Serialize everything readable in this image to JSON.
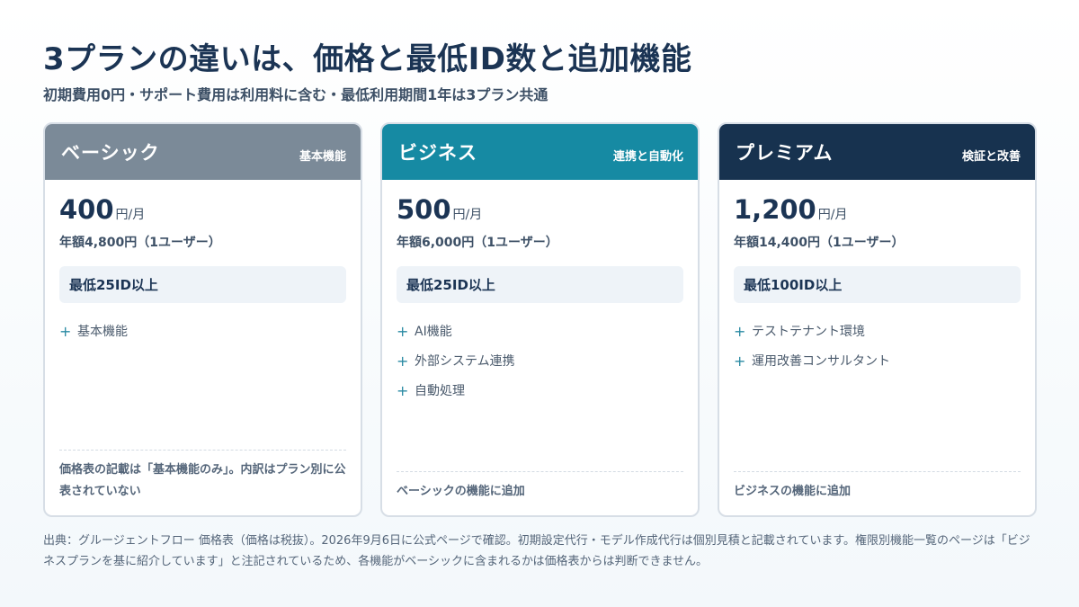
{
  "header": {
    "title": "3プランの違いは、価格と最低ID数と追加機能",
    "subtitle": "初期費用0円・サポート費用は利用料に含む・最低利用期間1年は3プラン共通"
  },
  "colors": {
    "basic": "#7b8a98",
    "business": "#168aa3",
    "premium": "#17324f"
  },
  "plans": [
    {
      "name": "ベーシック",
      "tag": "基本機能",
      "price": "400",
      "unit": "円/月",
      "annual": "年額4,800円（1ユーザー）",
      "min_ids": "最低25ID以上",
      "features": [
        "基本機能"
      ],
      "note": "価格表の記載は「基本機能のみ」。内訳はプラン別に公表されていない"
    },
    {
      "name": "ビジネス",
      "tag": "連携と自動化",
      "price": "500",
      "unit": "円/月",
      "annual": "年額6,000円（1ユーザー）",
      "min_ids": "最低25ID以上",
      "features": [
        "AI機能",
        "外部システム連携",
        "自動処理"
      ],
      "note": "ベーシックの機能に追加"
    },
    {
      "name": "プレミアム",
      "tag": "検証と改善",
      "price": "1,200",
      "unit": "円/月",
      "annual": "年額14,400円（1ユーザー）",
      "min_ids": "最低100ID以上",
      "features": [
        "テストテナント環境",
        "運用改善コンサルタント"
      ],
      "note": "ビジネスの機能に追加"
    }
  ],
  "footer": {
    "source": "出典：グルージェントフロー 価格表（価格は税抜）。2026年9月6日に公式ページで確認。初期設定代行・モデル作成代行は個別見積と記載されています。権限別機能一覧のページは「ビジネスプランを基に紹介しています」と注記されているため、各機能がベーシックに含まれるかは価格表からは判断できません。"
  }
}
